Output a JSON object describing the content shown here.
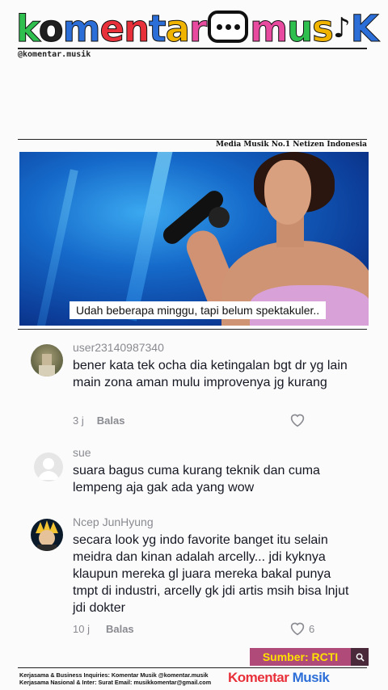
{
  "header": {
    "logo_part1": "komentar",
    "logo_part2": "mus",
    "logo_part3": "K",
    "handle": "@komentar.musik",
    "tagline": "Media Musik No.1 Netizen Indonesia"
  },
  "video": {
    "caption": "Udah beberapa minggu, tapi belum spektakuler.."
  },
  "comments": [
    {
      "username": "user23140987340",
      "text": "bener kata tek ocha dia ketingalan bgt dr yg lain main zona aman mulu improvenya jg kurang",
      "time": "3 j",
      "reply_label": "Balas",
      "likes": ""
    },
    {
      "username": "sue",
      "text": "suara bagus cuma kurang teknik dan cuma lempeng aja gak ada yang wow",
      "time": "",
      "reply_label": "",
      "likes": ""
    },
    {
      "username": "Ncep JunHyung",
      "text": "secara look yg indo favorite banget itu selain meidra dan kinan adalah arcelly... jdi kyknya klaupun mereka gl juara mereka bakal punya tmpt di industri, arcelly gk jdi artis msih bisa lnjut jdi dokter",
      "time": "10 j",
      "reply_label": "Balas",
      "likes": "6"
    }
  ],
  "source": {
    "label": "Sumber: RCTI",
    "icon": "search-icon"
  },
  "footer": {
    "line1": "Kerjasama & Business Inquiries: Komentar Musik @komentar.musik",
    "line2": "Kerjasama Nasional & Inter: Surat Email: musikkomentar@gmail.com",
    "logo1": "Komentar",
    "logo2": "Musik"
  },
  "colors": {
    "accent_yellow": "#ffe100",
    "source_bg": "#b04a78",
    "muted_text": "#8a8b91"
  }
}
